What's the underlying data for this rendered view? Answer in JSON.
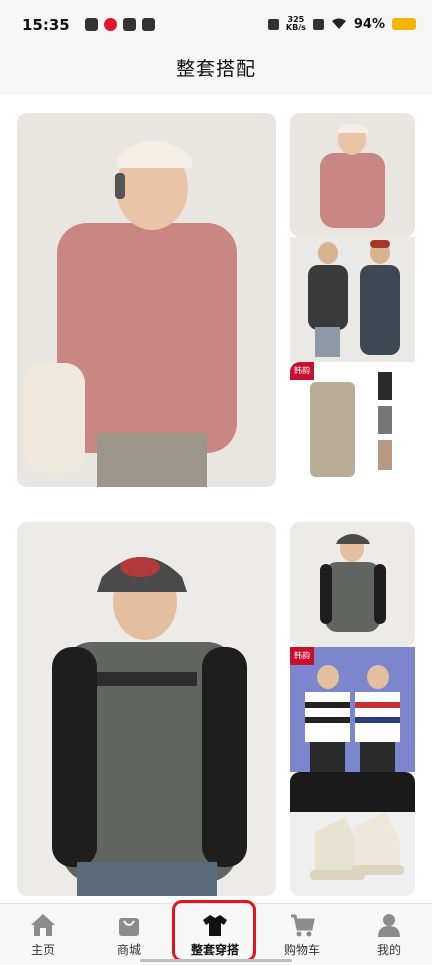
{
  "status_bar": {
    "time": "15:35",
    "net_speed_value": "325",
    "net_speed_unit": "KB/s",
    "battery_percent": "94%"
  },
  "header": {
    "title": "整套搭配"
  },
  "outfits": [
    {
      "tag": "",
      "thumb_tags": [
        "",
        "",
        "韩韵"
      ]
    },
    {
      "tag": "",
      "thumb_tags": [
        "",
        "韩韵",
        ""
      ]
    }
  ],
  "bottom_nav": {
    "items": [
      {
        "label": "主页",
        "icon": "home-icon"
      },
      {
        "label": "商城",
        "icon": "bag-icon"
      },
      {
        "label": "整套穿搭",
        "icon": "tshirt-icon",
        "active": true
      },
      {
        "label": "购物车",
        "icon": "cart-icon"
      },
      {
        "label": "我的",
        "icon": "user-icon"
      }
    ]
  },
  "colors": {
    "active_outline": "#e0161b",
    "battery": "#f2b705"
  }
}
